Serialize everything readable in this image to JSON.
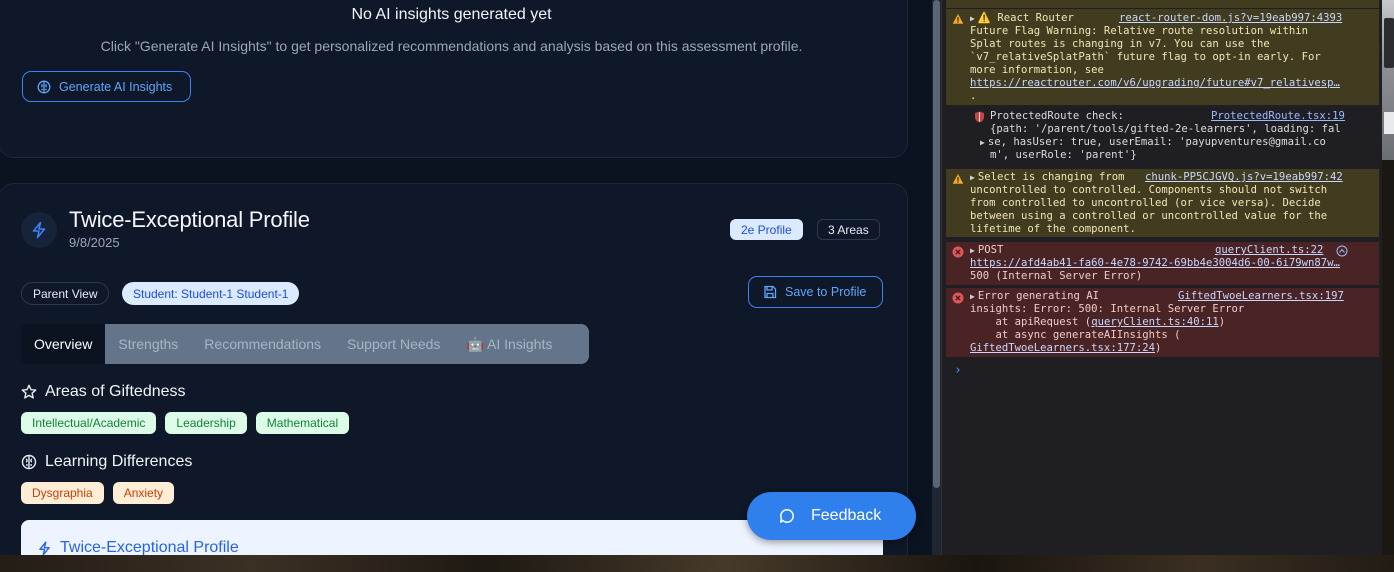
{
  "top_card": {
    "title": "No AI insights generated yet",
    "description": "Click \"Generate AI Insights\" to get personalized recommendations and analysis based on this assessment profile.",
    "generate_button": "Generate AI Insights"
  },
  "profile": {
    "title": "Twice-Exceptional Profile",
    "date": "9/8/2025",
    "badge_type": "2e Profile",
    "badge_areas": "3 Areas",
    "view_label": "Parent View",
    "student_label": "Student: Student-1 Student-1",
    "save_button": "Save to Profile"
  },
  "tabs": [
    {
      "label": "Overview",
      "active": true
    },
    {
      "label": "Strengths",
      "active": false
    },
    {
      "label": "Recommendations",
      "active": false
    },
    {
      "label": "Support Needs",
      "active": false
    },
    {
      "label": "🤖 AI Insights",
      "active": false
    }
  ],
  "sections": {
    "giftedness": {
      "title": "Areas of Giftedness",
      "items": [
        "Intellectual/Academic",
        "Leadership",
        "Mathematical"
      ]
    },
    "learning": {
      "title": "Learning Differences",
      "items": [
        "Dysgraphia",
        "Anxiety"
      ]
    }
  },
  "inner_panel_title": "Twice-Exceptional Profile",
  "feedback_button": "Feedback",
  "colors": {
    "app_bg": "#0b1220",
    "card_bg": "#0f1828",
    "accent_blue": "#3b82f6",
    "badge_blue_bg": "#dbeafe",
    "chip_green_bg": "#dcfce7",
    "chip_orange_bg": "#ffedd5",
    "feedback_bg": "#2f80ed",
    "console_bg": "#1f1f23",
    "console_warn_bg": "#413b1f",
    "console_error_bg": "#4a2425"
  },
  "console": {
    "warn_router": {
      "lines": [
        "⚠️ React Router",
        "Future Flag Warning: Relative route resolution within",
        "Splat routes is changing in v7. You can use the",
        "`v7_relativeSplatPath` future flag to opt-in early. For",
        "more information, see"
      ],
      "source": "react-router-dom.js?v=19eab997:4393",
      "url": "https://reactrouter.com/v6/upgrading/future#v7_relativesp…",
      "trailing": "."
    },
    "protected_route": {
      "label": "ProtectedRoute check:",
      "source": "ProtectedRoute.tsx:19",
      "obj_line1": "{path: '/parent/tools/gifted-2e-learners', loading: fal",
      "obj_line2": "se, hasUser: true, userEmail: 'payupventures@gmail.co",
      "obj_line3": "m', userRole: 'parent'}"
    },
    "warn_select": {
      "lines": [
        "Select is changing from",
        "uncontrolled to controlled. Components should not switch",
        "from controlled to uncontrolled (or vice versa). Decide",
        "between using a controlled or uncontrolled value for the",
        "lifetime of the component."
      ],
      "source": "chunk-PP5CJGVQ.js?v=19eab997:42"
    },
    "error_post": {
      "label": "POST",
      "source": "queryClient.ts:22",
      "url": "https://afd4ab41-fa60-4e78-9742-69bb4e3004d6-00-6i79wn87w…",
      "status": "500 (Internal Server Error)"
    },
    "error_generate": {
      "line1": "Error generating AI",
      "source": "GiftedTwoeLearners.tsx:197",
      "line2": "insights: Error: 500: Internal Server Error",
      "line3": "    at apiRequest (",
      "line3_link": "queryClient.ts:40:11",
      "line3_end": ")",
      "line4": "    at async generateAIInsights (",
      "line5_link": "GiftedTwoeLearners.tsx:177:24",
      "line5_end": ")"
    },
    "prompt_symbol": "›"
  }
}
